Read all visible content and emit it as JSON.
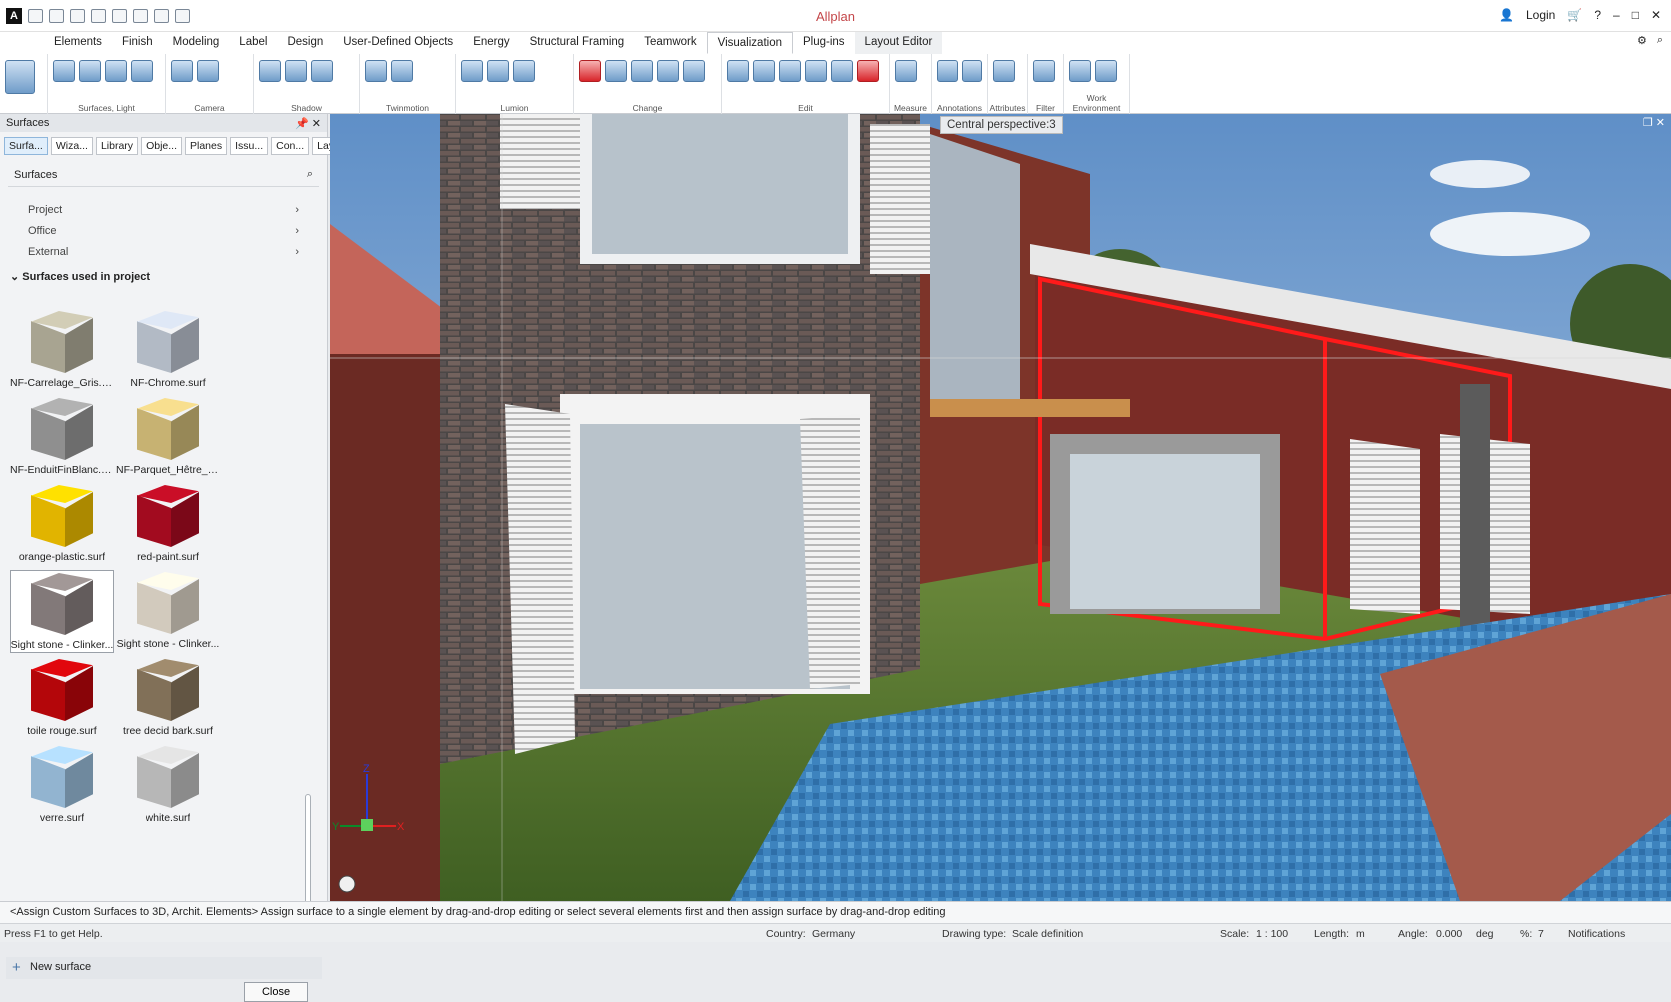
{
  "app": {
    "title": "Allplan",
    "logo": "A",
    "login_label": "Login"
  },
  "menu": {
    "tabs": [
      {
        "label": "Elements"
      },
      {
        "label": "Finish"
      },
      {
        "label": "Modeling"
      },
      {
        "label": "Label"
      },
      {
        "label": "Design"
      },
      {
        "label": "User-Defined Objects"
      },
      {
        "label": "Energy"
      },
      {
        "label": "Structural Framing"
      },
      {
        "label": "Teamwork"
      },
      {
        "label": "Visualization"
      },
      {
        "label": "Plug-ins"
      },
      {
        "label": "Layout Editor"
      }
    ]
  },
  "ribbon": {
    "groups": [
      {
        "label": "Surfaces, Light"
      },
      {
        "label": "Camera"
      },
      {
        "label": "Shadow"
      },
      {
        "label": "Twinmotion"
      },
      {
        "label": "Lumion"
      },
      {
        "label": "Change"
      },
      {
        "label": "Edit"
      },
      {
        "label": "Measure"
      },
      {
        "label": "Annotations"
      },
      {
        "label": "Attributes"
      },
      {
        "label": "Filter"
      },
      {
        "label": "Work Environment"
      }
    ]
  },
  "panel": {
    "title": "Surfaces",
    "tabs": [
      "Surfa...",
      "Wiza...",
      "Library",
      "Obje...",
      "Planes",
      "Issu...",
      "Con...",
      "Layers"
    ],
    "search_label": "Surfaces",
    "nav": [
      "Project",
      "Office",
      "External"
    ],
    "used_heading": "Surfaces used in project",
    "surfaces": [
      {
        "name": "NF-Carrelage_Gris.surf",
        "color": "#b7b29e"
      },
      {
        "name": "NF-Chrome.surf",
        "color": "#c2cad6"
      },
      {
        "name": "NF-EnduitFinBlanc.s...",
        "color": "#9b9b9b"
      },
      {
        "name": "NF-Parquet_Hêtre_H...",
        "color": "#d8c27c"
      },
      {
        "name": "orange-plastic.surf",
        "color": "#f5c400"
      },
      {
        "name": "red-paint.surf",
        "color": "#b00c22"
      },
      {
        "name": "Sight stone - Clinker...",
        "color": "#8d8483"
      },
      {
        "name": "Sight stone - Clinker...",
        "color": "#e4dccd"
      },
      {
        "name": "toile rouge.surf",
        "color": "#c4060b"
      },
      {
        "name": "tree decid bark.surf",
        "color": "#8c7a60"
      },
      {
        "name": "verre.surf",
        "color": "#9fc4e2"
      },
      {
        "name": "white.surf",
        "color": "#c7c7c7"
      }
    ],
    "new_surface": "New surface",
    "close": "Close"
  },
  "viewport": {
    "label": "Central perspective:3",
    "axis_z": "Z",
    "axis_y": "Y",
    "axis_x": "X"
  },
  "status": {
    "message": "<Assign Custom Surfaces to 3D, Archit. Elements> Assign surface to a single element by drag-and-drop editing or select several elements first and then assign surface by drag-and-drop editing"
  },
  "footer": {
    "help": "Press F1 to get Help.",
    "country_label": "Country:",
    "country": "Germany",
    "drawing_type_label": "Drawing type:",
    "drawing_type": "Scale definition",
    "scale_label": "Scale:",
    "scale": "1 : 100",
    "length_label": "Length:",
    "length_unit": "m",
    "angle_label": "Angle:",
    "angle": "0.000",
    "angle_unit": "deg",
    "percent_label": "%:",
    "percent": "7",
    "notifications": "Notifications"
  }
}
